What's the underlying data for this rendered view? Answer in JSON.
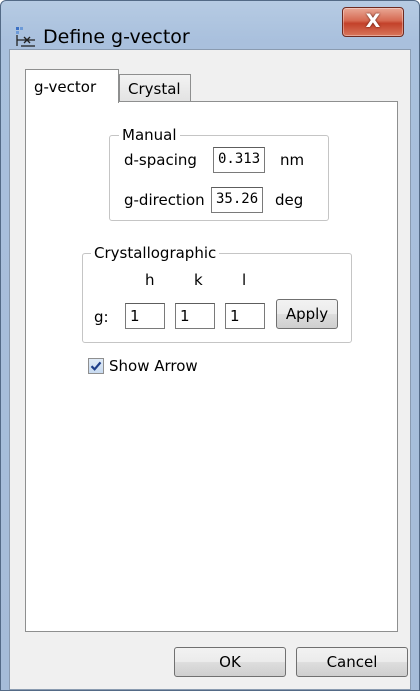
{
  "window": {
    "title": "Define g-vector",
    "close_glyph": "X",
    "title_icon": "define-g-vector-app-icon"
  },
  "tabs": [
    {
      "label": "g-vector",
      "active": true
    },
    {
      "label": "Crystal",
      "active": false
    }
  ],
  "manual": {
    "legend": "Manual",
    "d_spacing": {
      "label": "d-spacing",
      "value": "0.313",
      "unit": "nm"
    },
    "g_direction": {
      "label": "g-direction",
      "value": "35.26",
      "unit": "deg"
    }
  },
  "crystallographic": {
    "legend": "Crystallographic",
    "headers": [
      "h",
      "k",
      "l"
    ],
    "row_label": "g:",
    "values": [
      "1",
      "1",
      "1"
    ],
    "apply_label": "Apply"
  },
  "show_arrow": {
    "label": "Show Arrow",
    "checked": true
  },
  "footer": {
    "ok_label": "OK",
    "cancel_label": "Cancel"
  },
  "colors": {
    "titlebar": "#a9c0dd",
    "close_button": "#c3412a",
    "client_bg": "#f0f0f0"
  }
}
